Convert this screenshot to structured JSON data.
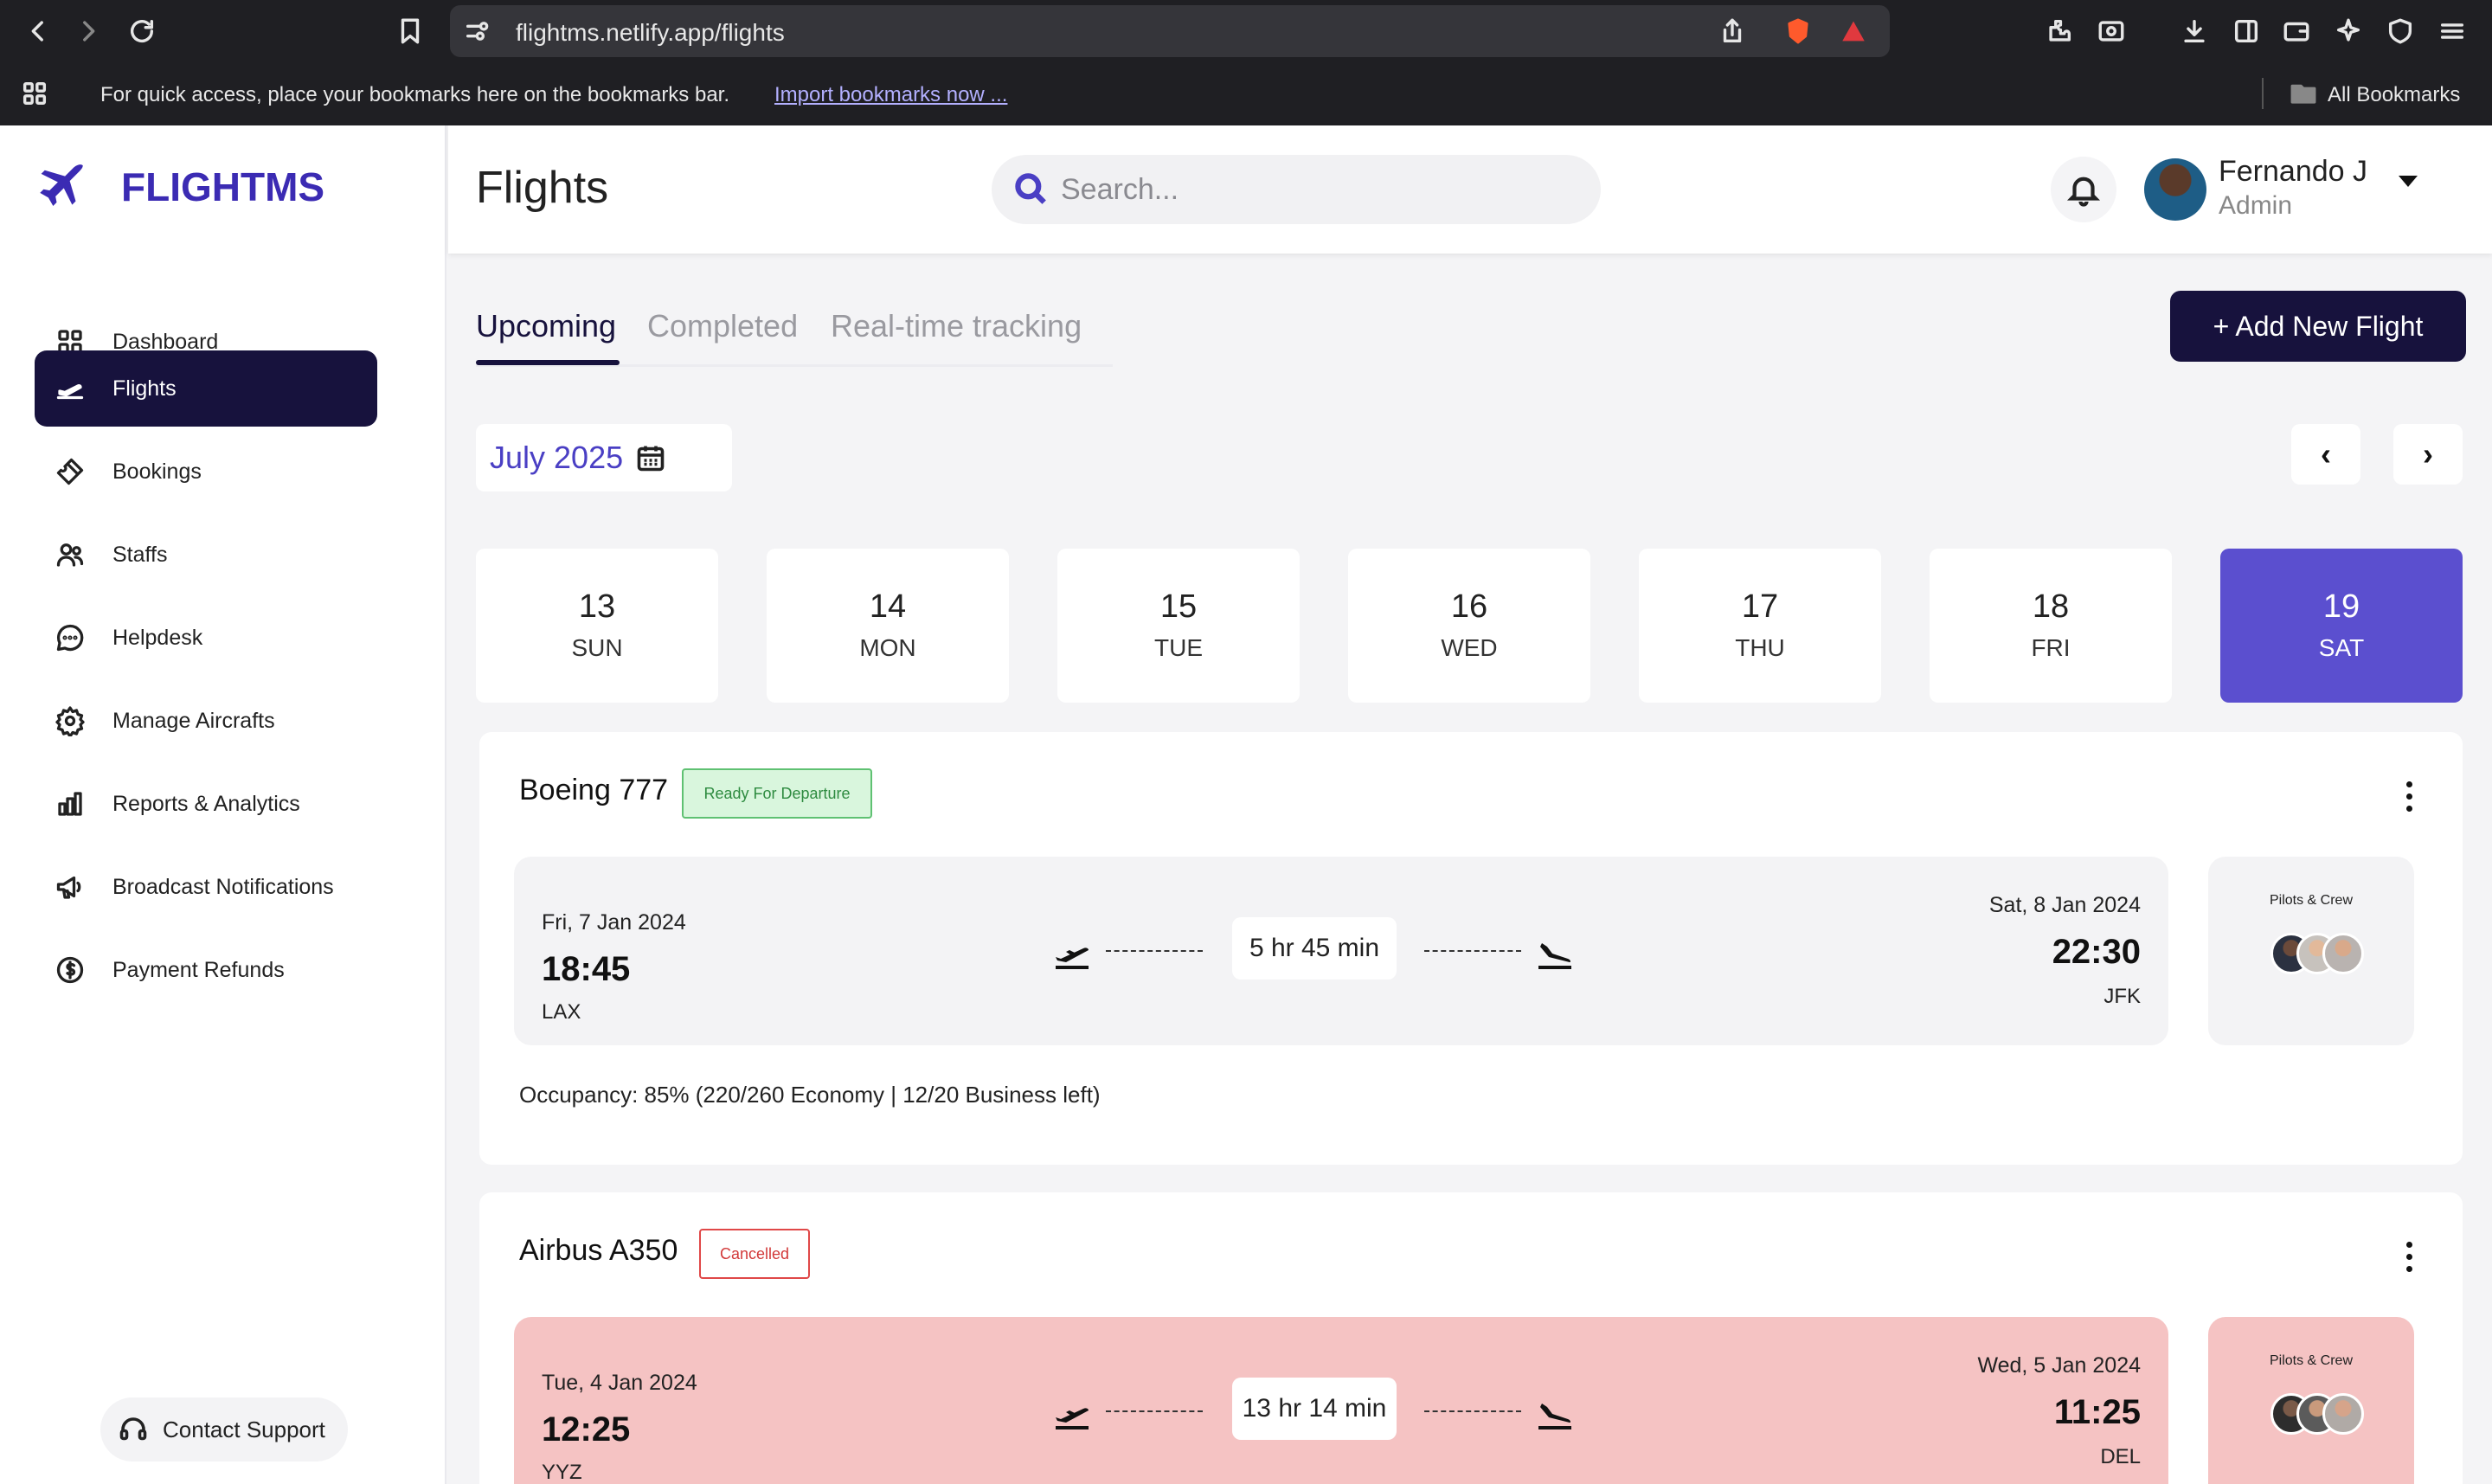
{
  "browser": {
    "url": "flightms.netlify.app/flights",
    "bookmarks_message": "For quick access, place your bookmarks here on the bookmarks bar.",
    "import_link": "Import bookmarks now ...",
    "all_bookmarks": "All Bookmarks"
  },
  "app": {
    "logo": "FLIGHTMS",
    "brand_color": "#3b2bb3",
    "accent_color": "#5b4fcf",
    "dark_color": "#17123d"
  },
  "sidebar": {
    "items": [
      {
        "label": "Dashboard",
        "icon": "grid-icon",
        "active": false
      },
      {
        "label": "Flights",
        "icon": "plane-takeoff-icon",
        "active": true
      },
      {
        "label": "Bookings",
        "icon": "ticket-icon",
        "active": false
      },
      {
        "label": "Staffs",
        "icon": "users-icon",
        "active": false
      },
      {
        "label": "Helpdesk",
        "icon": "chat-icon",
        "active": false
      },
      {
        "label": "Manage Aircrafts",
        "icon": "gear-icon",
        "active": false
      },
      {
        "label": "Reports & Analytics",
        "icon": "bar-chart-icon",
        "active": false
      },
      {
        "label": "Broadcast Notifications",
        "icon": "megaphone-icon",
        "active": false
      },
      {
        "label": "Payment Refunds",
        "icon": "dollar-icon",
        "active": false
      }
    ],
    "support_label": "Contact Support"
  },
  "header": {
    "title": "Flights",
    "search_placeholder": "Search...",
    "user_name": "Fernando J",
    "user_role": "Admin"
  },
  "tabs": [
    "Upcoming",
    "Completed",
    "Real-time tracking"
  ],
  "add_button": "+ Add New Flight",
  "calendar": {
    "month": "July 2025",
    "prev": "‹",
    "next": "›",
    "days": [
      {
        "num": "13",
        "dow": "SUN"
      },
      {
        "num": "14",
        "dow": "MON"
      },
      {
        "num": "15",
        "dow": "TUE"
      },
      {
        "num": "16",
        "dow": "WED"
      },
      {
        "num": "17",
        "dow": "THU"
      },
      {
        "num": "18",
        "dow": "FRI"
      },
      {
        "num": "19",
        "dow": "SAT"
      }
    ],
    "selected_day": "19"
  },
  "flights": [
    {
      "aircraft": "Boeing 777",
      "status": "Ready For Departure",
      "dep_date": "Fri, 7 Jan 2024",
      "dep_time": "18:45",
      "dep_code": "LAX",
      "duration": "5 hr 45 min",
      "arr_date": "Sat, 8 Jan 2024",
      "arr_time": "22:30",
      "arr_code": "JFK",
      "crew_label": "Pilots & Crew",
      "occupancy": "Occupancy: 85% (220/260 Economy | 12/20 Business left)"
    },
    {
      "aircraft": "Airbus A350",
      "status": "Cancelled",
      "dep_date": "Tue, 4 Jan 2024",
      "dep_time": "12:25",
      "dep_code": "YYZ",
      "duration": "13 hr 14 min",
      "arr_date": "Wed, 5 Jan 2024",
      "arr_time": "11:25",
      "arr_code": "DEL",
      "crew_label": "Pilots & Crew"
    }
  ]
}
